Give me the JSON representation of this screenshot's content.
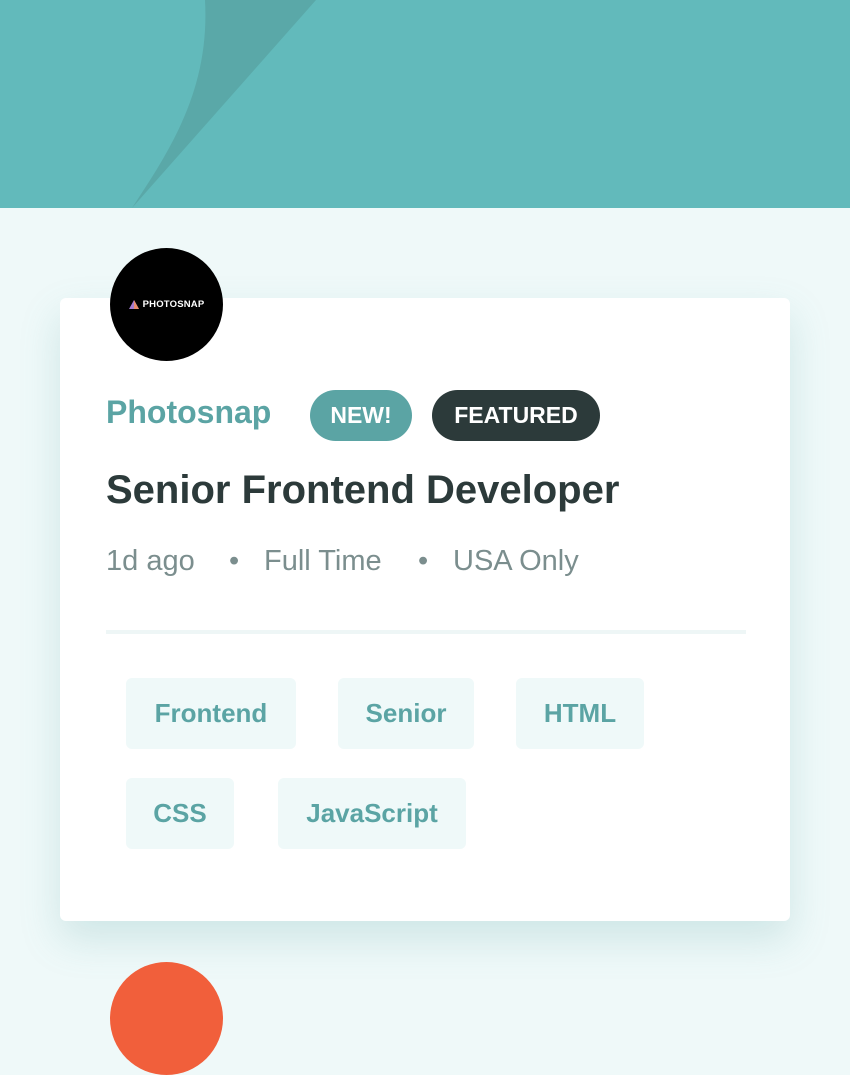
{
  "colors": {
    "primary": "#5ba4a4",
    "header_bg": "#62babb",
    "page_bg": "#eff9f9",
    "dark": "#2c3a3a",
    "muted": "#7b8e8e",
    "next_logo": "#f15f3b"
  },
  "job": {
    "logo_text": "PHOTOSNAP",
    "company": "Photosnap",
    "badges": {
      "new": "NEW!",
      "featured": "FEATURED"
    },
    "position": "Senior Frontend Developer",
    "posted_at": "1d ago",
    "separator": "•",
    "contract": "Full Time",
    "location": "USA Only",
    "tags": [
      "Frontend",
      "Senior",
      "HTML",
      "CSS",
      "JavaScript"
    ]
  }
}
